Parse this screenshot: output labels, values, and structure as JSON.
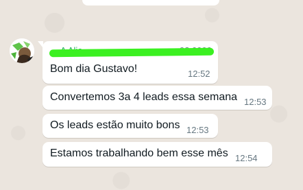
{
  "chat": {
    "sender": {
      "name": "A Alia",
      "phone": "98 9999",
      "avatar_icon": "person-avatar-icon",
      "redaction_color": "#3bf021"
    },
    "messages": [
      {
        "text": "Bom dia Gustavo!",
        "time": "12:52"
      },
      {
        "text": "Convertemos 3a 4 leads essa semana",
        "time": "12:53"
      },
      {
        "text": "Os leads estão muito bons",
        "time": "12:53"
      },
      {
        "text": "Estamos trabalhando bem esse mês",
        "time": "12:54"
      }
    ]
  }
}
